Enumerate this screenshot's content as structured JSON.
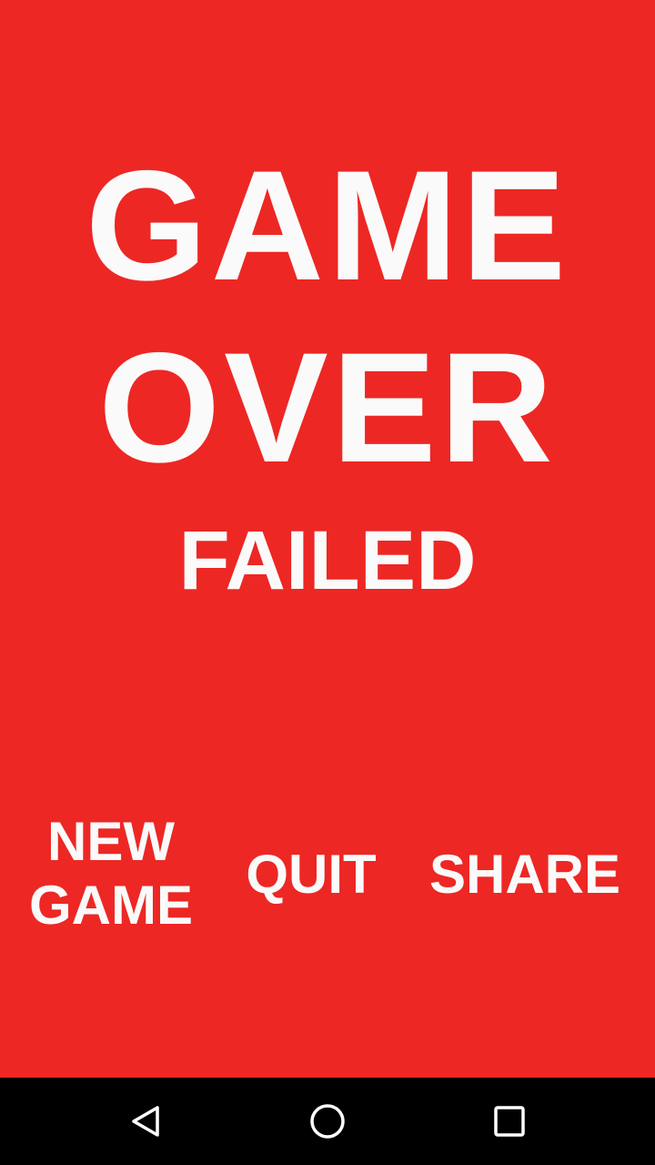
{
  "game": {
    "title_line1": "GAME",
    "title_line2": "OVER",
    "status": "FAILED",
    "colors": {
      "background": "#ED2724",
      "text": "#FAFAFA"
    }
  },
  "actions": {
    "new_game_line1": "NEW",
    "new_game_line2": "GAME",
    "quit": "QUIT",
    "share": "SHARE"
  },
  "navbar": {
    "icons": [
      "back-icon",
      "home-icon",
      "recent-apps-icon"
    ],
    "colors": {
      "background": "#000000",
      "icon": "#FFFFFF"
    }
  }
}
